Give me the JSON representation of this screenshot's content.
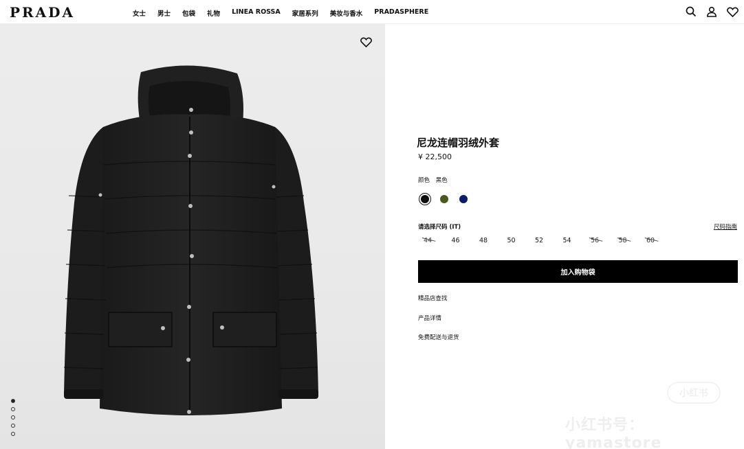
{
  "header": {
    "logo": "PRADA",
    "nav": [
      "女士",
      "男士",
      "包袋",
      "礼物",
      "LINEA ROSSA",
      "家居系列",
      "美妆与香水",
      "PRADASPHERE"
    ],
    "icons": [
      "search-icon",
      "account-icon",
      "wishlist-icon"
    ]
  },
  "gallery": {
    "image": "black-nylon-hooded-down-jacket",
    "dots_count": 5,
    "active_dot": 0
  },
  "product": {
    "title": "尼龙连帽羽绒外套",
    "price": "¥ 22,500",
    "color_label": "颜色",
    "color_value": "黑色",
    "swatches": [
      {
        "color": "#0d0d0d",
        "selected": true
      },
      {
        "color": "#4a5a1e",
        "selected": false
      },
      {
        "color": "#0b1c6b",
        "selected": false
      }
    ],
    "size_label": "请选择尺码 (IT)",
    "size_guide": "尺码指南",
    "sizes": [
      {
        "label": "44",
        "available": false
      },
      {
        "label": "46",
        "available": true
      },
      {
        "label": "48",
        "available": true
      },
      {
        "label": "50",
        "available": true
      },
      {
        "label": "52",
        "available": true
      },
      {
        "label": "54",
        "available": true
      },
      {
        "label": "56",
        "available": false
      },
      {
        "label": "58",
        "available": false
      },
      {
        "label": "60",
        "available": false
      }
    ],
    "add_to_bag": "加入购物袋",
    "links": [
      "精品店查找",
      "产品详情",
      "免费配送与退货"
    ]
  },
  "watermark": {
    "badge": "小红书",
    "text": "小红书号：  yamastore"
  },
  "colors": {
    "accent": "#000000",
    "background": "#ffffff",
    "image_bg": "#ebebeb"
  }
}
